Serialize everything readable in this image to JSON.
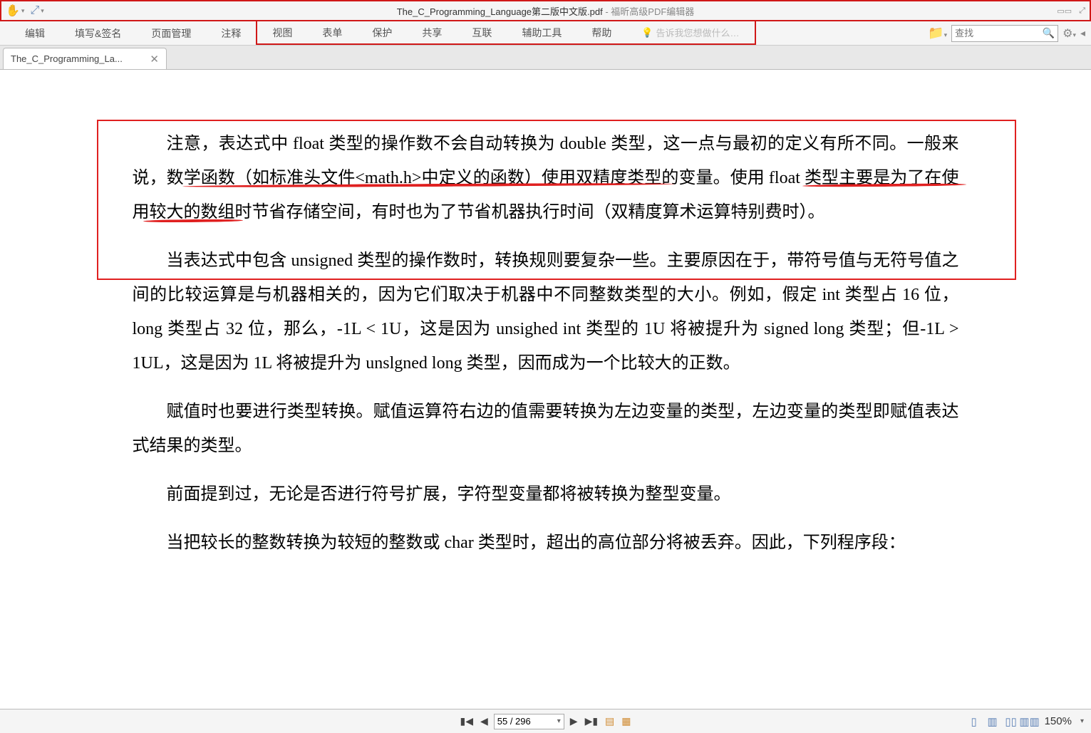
{
  "titlebar": {
    "doc_title": "The_C_Programming_Language第二版中文版.pdf",
    "separator": " - ",
    "app_name": "福昕高级PDF编辑器"
  },
  "menubar": {
    "items": [
      "编辑",
      "填写&签名",
      "页面管理",
      "注释",
      "视图",
      "表单",
      "保护",
      "共享",
      "互联",
      "辅助工具",
      "帮助"
    ],
    "tell_me": "告诉我您想做什么…",
    "search_placeholder": "查找"
  },
  "tab": {
    "label": "The_C_Programming_La..."
  },
  "doc": {
    "p1": "注意，表达式中 float 类型的操作数不会自动转换为 double 类型，这一点与最初的定义有所不同。一般来说，数学函数（如标准头文件<math.h>中定义的函数）使用双精度类型的变量。使用 float 类型主要是为了在使用较大的数组时节省存储空间，有时也为了节省机器执行时间（双精度算术运算特别费时）。",
    "p2": "当表达式中包含 unsigned 类型的操作数时，转换规则要复杂一些。主要原因在于，带符号值与无符号值之间的比较运算是与机器相关的，因为它们取决于机器中不同整数类型的大小。例如，假定 int 类型占 16 位，long 类型占 32 位，那么，-1L < 1U，这是因为 unsighed int 类型的 1U 将被提升为 signed long 类型；但-1L > 1UL，这是因为 1L 将被提升为 unslgned long 类型，因而成为一个比较大的正数。",
    "p3": "赋值时也要进行类型转换。赋值运算符右边的值需要转换为左边变量的类型，左边变量的类型即赋值表达式结果的类型。",
    "p4": "前面提到过，无论是否进行符号扩展，字符型变量都将被转换为整型变量。",
    "p5": "当把较长的整数转换为较短的整数或 char 类型时，超出的高位部分将被丢弃。因此，下列程序段："
  },
  "bottombar": {
    "page_display": "55 / 296",
    "zoom": "150%"
  }
}
